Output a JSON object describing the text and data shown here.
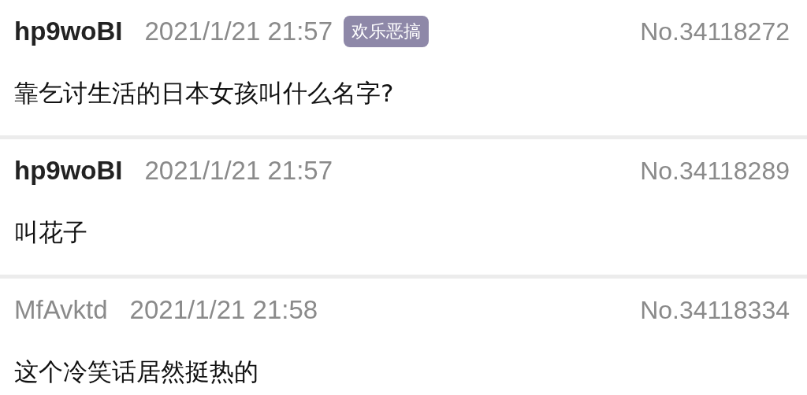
{
  "posts": [
    {
      "user": "hp9woBI",
      "po": true,
      "time": "2021/1/21 21:57",
      "tag": "欢乐恶搞",
      "number": "No.34118272",
      "text": "靠乞讨生活的日本女孩叫什么名字?"
    },
    {
      "user": "hp9woBI",
      "po": true,
      "time": "2021/1/21 21:57",
      "number": "No.34118289",
      "text": "叫花子"
    },
    {
      "user": "MfAvktd",
      "po": false,
      "time": "2021/1/21 21:58",
      "number": "No.34118334",
      "text": "这个冷笑话居然挺热的"
    }
  ]
}
